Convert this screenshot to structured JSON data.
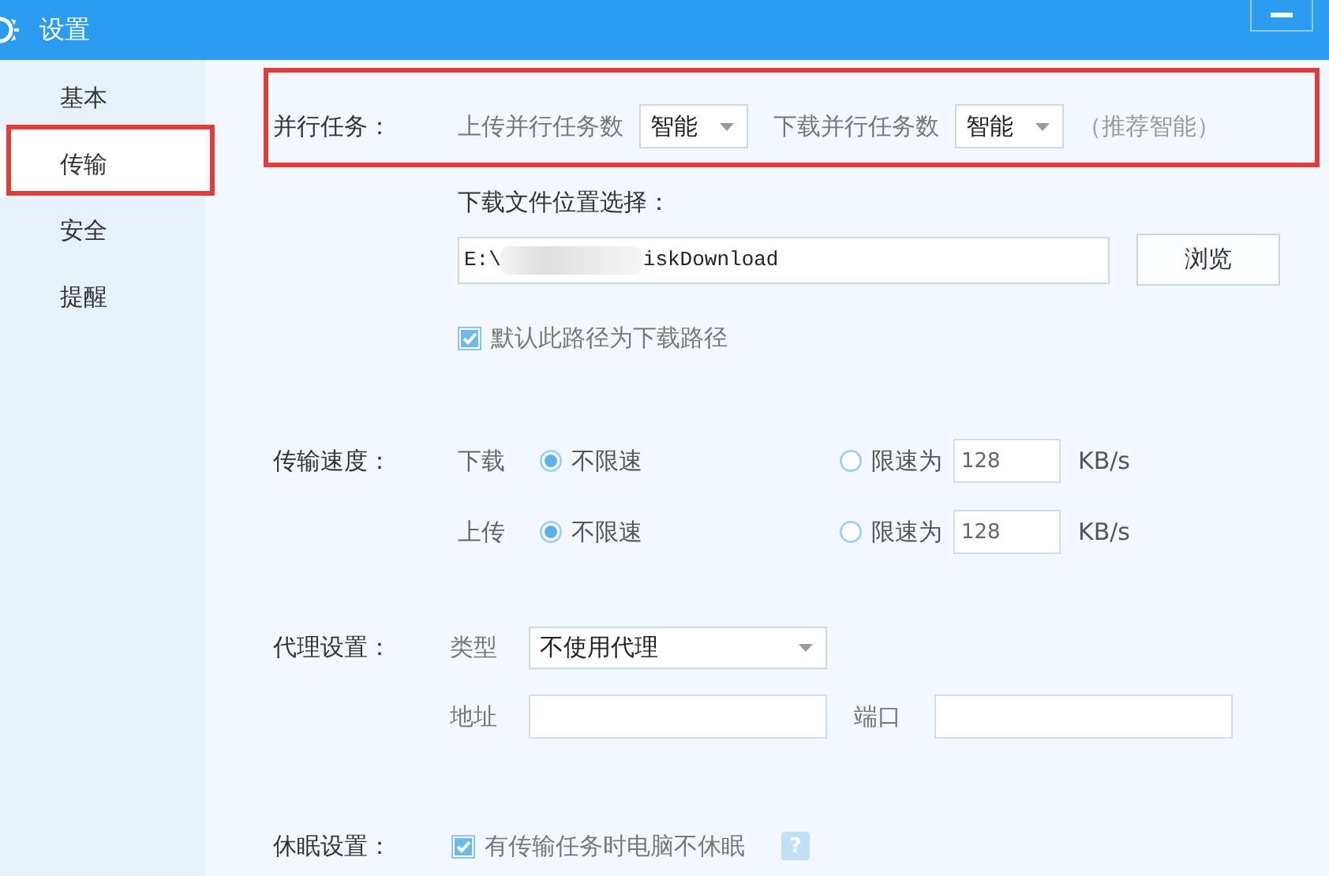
{
  "window": {
    "title": "设置"
  },
  "sidebar": {
    "items": [
      {
        "label": "基本",
        "selected": false,
        "highlighted": false
      },
      {
        "label": "传输",
        "selected": true,
        "highlighted": true
      },
      {
        "label": "安全",
        "selected": false,
        "highlighted": false
      },
      {
        "label": "提醒",
        "selected": false,
        "highlighted": false
      }
    ]
  },
  "parallel_tasks": {
    "label": "并行任务：",
    "highlighted": true,
    "upload_label": "上传并行任务数",
    "upload_value": "智能",
    "download_label": "下载并行任务数",
    "download_value": "智能",
    "hint": "（推荐智能）"
  },
  "download_location": {
    "label": "下载文件位置选择：",
    "path_start": "E:\\",
    "path_end": "iskDownload",
    "browse_button": "浏览",
    "default_checkbox": {
      "label": "默认此路径为下载路径",
      "checked": true
    }
  },
  "speed": {
    "label": "传输速度：",
    "rows": [
      {
        "direction": "下载",
        "unlimited": {
          "label": "不限速",
          "selected": true
        },
        "limited": {
          "label": "限速为",
          "selected": false,
          "value": "128",
          "unit": "KB/s"
        }
      },
      {
        "direction": "上传",
        "unlimited": {
          "label": "不限速",
          "selected": true
        },
        "limited": {
          "label": "限速为",
          "selected": false,
          "value": "128",
          "unit": "KB/s"
        }
      }
    ]
  },
  "proxy": {
    "label": "代理设置：",
    "type_label": "类型",
    "type_value": "不使用代理",
    "address_label": "地址",
    "port_label": "端口"
  },
  "sleep": {
    "label": "休眠设置：",
    "checkbox": {
      "label": "有传输任务时电脑不休眠",
      "checked": true
    },
    "help": "?"
  }
}
